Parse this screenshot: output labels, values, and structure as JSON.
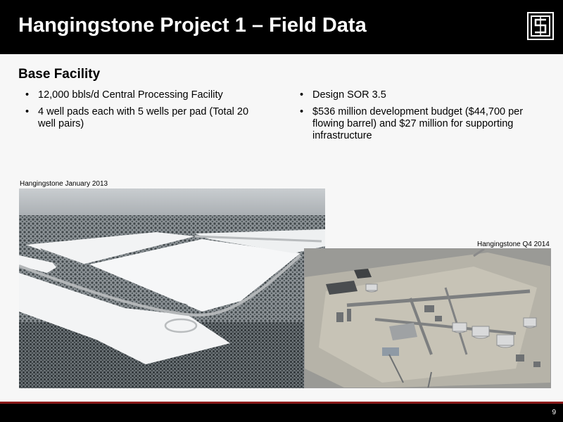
{
  "header": {
    "title": "Hangingstone Project 1 – Field Data"
  },
  "section": {
    "subtitle": "Base Facility"
  },
  "left_bullets": [
    "12,000 bbls/d Central Processing Facility",
    "4 well pads each with 5 wells per pad (Total 20 well pairs)"
  ],
  "right_bullets": [
    "Design SOR 3.5",
    "$536 million development budget ($44,700 per flowing barrel) and $27 million for supporting infrastructure"
  ],
  "images": {
    "photo1_caption": "Hangingstone January 2013",
    "photo2_caption": "Hangingstone Q4 2014"
  },
  "footer": {
    "page_number": "9",
    "accent_color": "#8b1a1a"
  }
}
